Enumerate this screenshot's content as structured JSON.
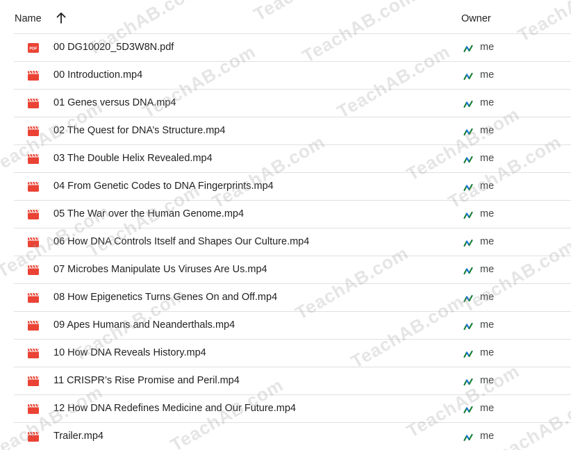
{
  "header": {
    "name_label": "Name",
    "owner_label": "Owner",
    "sort_icon": "arrow-up-icon"
  },
  "colors": {
    "pdf_red": "#ea4335",
    "video_red": "#ea4335",
    "owner_green": "#188038",
    "owner_blue": "#1a73e8",
    "divider": "#e0e0e0",
    "watermark": "#a0a0a0"
  },
  "files": [
    {
      "name": "00 DG10020_5D3W8N.pdf",
      "type": "pdf",
      "owner": "me"
    },
    {
      "name": "00 Introduction.mp4",
      "type": "video",
      "owner": "me"
    },
    {
      "name": "01 Genes versus DNA.mp4",
      "type": "video",
      "owner": "me"
    },
    {
      "name": "02 The Quest for DNA’s Structure.mp4",
      "type": "video",
      "owner": "me"
    },
    {
      "name": "03 The Double Helix Revealed.mp4",
      "type": "video",
      "owner": "me"
    },
    {
      "name": "04 From Genetic Codes to DNA Fingerprints.mp4",
      "type": "video",
      "owner": "me"
    },
    {
      "name": "05 The War over the Human Genome.mp4",
      "type": "video",
      "owner": "me"
    },
    {
      "name": "06 How DNA Controls Itself and Shapes Our Culture.mp4",
      "type": "video",
      "owner": "me"
    },
    {
      "name": "07 Microbes Manipulate Us Viruses Are Us.mp4",
      "type": "video",
      "owner": "me"
    },
    {
      "name": "08 How Epigenetics Turns Genes On and Off.mp4",
      "type": "video",
      "owner": "me"
    },
    {
      "name": "09 Apes Humans and Neanderthals.mp4",
      "type": "video",
      "owner": "me"
    },
    {
      "name": "10 How DNA Reveals History.mp4",
      "type": "video",
      "owner": "me"
    },
    {
      "name": "11 CRISPR’s Rise Promise and Peril.mp4",
      "type": "video",
      "owner": "me"
    },
    {
      "name": "12 How DNA Redefines Medicine and Our Future.mp4",
      "type": "video",
      "owner": "me"
    },
    {
      "name": "Trailer.mp4",
      "type": "video",
      "owner": "me"
    }
  ],
  "watermark_text": "TeachAB.com"
}
